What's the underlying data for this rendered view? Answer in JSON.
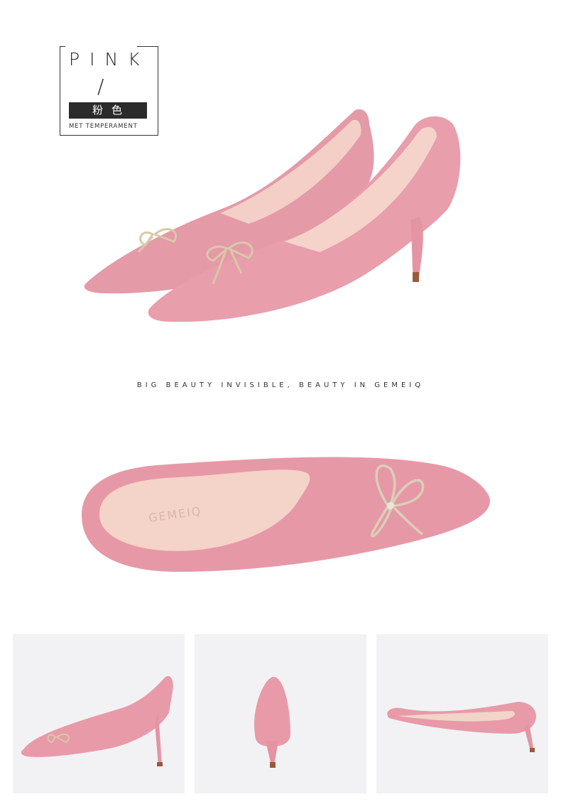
{
  "color_label": {
    "word": "PINK",
    "slash": "/",
    "chinese": "粉色",
    "subtitle": "MET TEMPERAMENT"
  },
  "tagline": "BIG BEAUTY INVISIBLE, BEAUTY IN GEMEIQ",
  "insole_brand": "GEMEIQ",
  "colors": {
    "suede_pink": "#e59aa8",
    "suede_dark": "#c97888",
    "lining": "#f3cfc7",
    "heel_tip": "#9a5a3a",
    "thumb_bg": "#f2f2f5",
    "text": "#222222"
  },
  "icons": [
    "shoe-pair-image",
    "shoe-top-view-image",
    "shoe-side-view-image",
    "shoe-back-view-image",
    "shoe-sole-view-image"
  ]
}
